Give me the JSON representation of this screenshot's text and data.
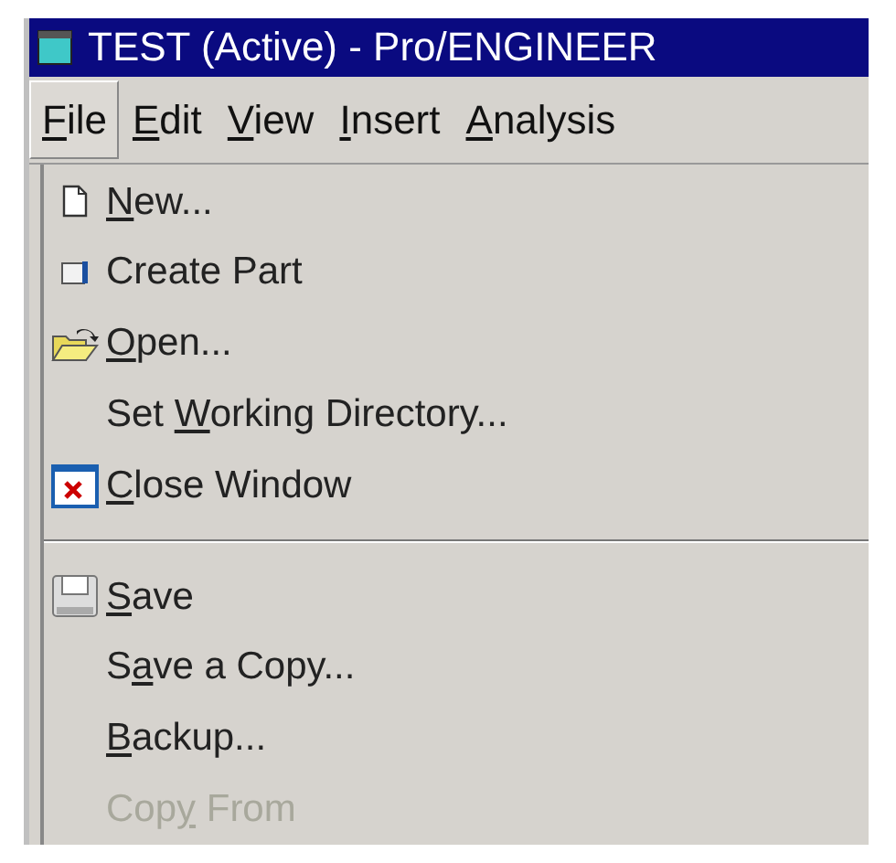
{
  "window": {
    "title": "TEST (Active) - Pro/ENGINEER"
  },
  "menu_bar": [
    {
      "key": "F",
      "post": "ile",
      "selected": true
    },
    {
      "key": "E",
      "post": "dit",
      "selected": false
    },
    {
      "key": "V",
      "post": "iew",
      "selected": false
    },
    {
      "key": "I",
      "post": "nsert",
      "selected": false
    },
    {
      "key": "A",
      "post": "nalysis",
      "selected": false
    }
  ],
  "file_menu": [
    {
      "kind": "item",
      "key": "N",
      "post": "ew...",
      "disabled": false
    },
    {
      "kind": "item",
      "pre": "Create Part",
      "disabled": false
    },
    {
      "kind": "item",
      "key": "O",
      "post": "pen...",
      "disabled": false
    },
    {
      "kind": "item",
      "pre": "Set ",
      "key": "W",
      "post": "orking Directory...",
      "disabled": false
    },
    {
      "kind": "item",
      "key": "C",
      "post": "lose Window",
      "disabled": false
    },
    {
      "kind": "separator"
    },
    {
      "kind": "item",
      "key": "S",
      "post": "ave",
      "disabled": false
    },
    {
      "kind": "item",
      "pre": "S",
      "key": "a",
      "post": "ve a Copy...",
      "disabled": false
    },
    {
      "kind": "item",
      "key": "B",
      "post": "ackup...",
      "disabled": false
    },
    {
      "kind": "item",
      "pre": "Cop",
      "key": "y",
      "post": " From",
      "disabled": true
    }
  ]
}
